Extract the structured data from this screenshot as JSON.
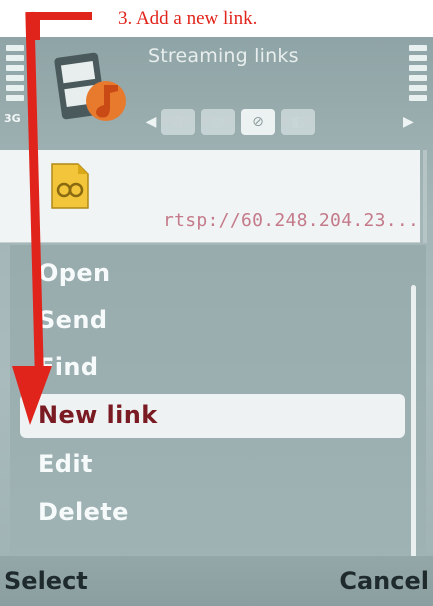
{
  "caption": "3. Add a new link.",
  "status": {
    "signal_label": "3G"
  },
  "app": {
    "title": "Streaming links",
    "icon": "media-film-icon"
  },
  "tabs": [
    {
      "icon": "music-note-icon",
      "glyph": "♫"
    },
    {
      "icon": "microphone-icon",
      "glyph": "◍"
    },
    {
      "icon": "link-icon",
      "glyph": "⊘"
    },
    {
      "icon": "video-icon",
      "glyph": "◧"
    }
  ],
  "list": {
    "item_icon": "file-link-icon",
    "url": "rtsp://60.248.204.23..."
  },
  "menu": {
    "items": [
      "Open",
      "Send",
      "Find",
      "New link",
      "Edit",
      "Delete"
    ],
    "selected": "New link"
  },
  "softkeys": {
    "left": "Select",
    "right": "Cancel"
  },
  "colors": {
    "annotation": "#e0241b",
    "selected_text": "#7a1a22"
  }
}
